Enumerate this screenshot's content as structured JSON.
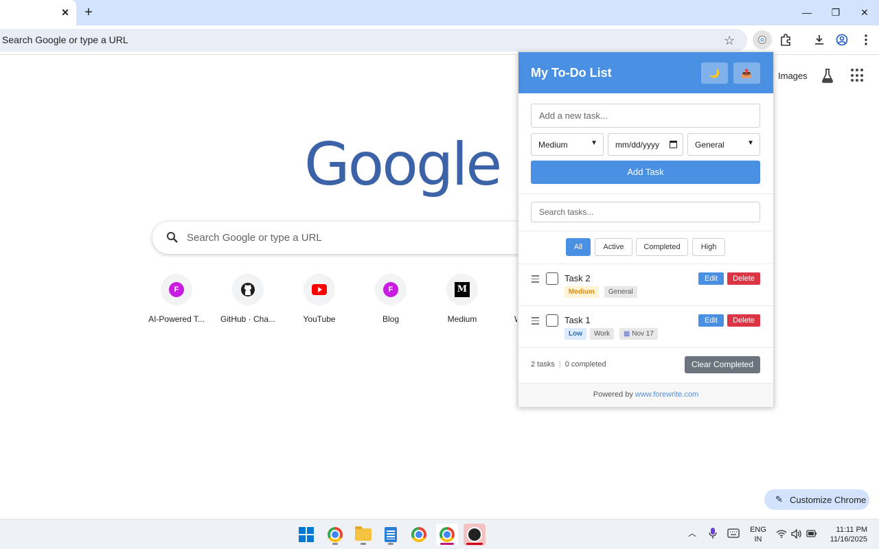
{
  "browser": {
    "omnibox_text": "Search Google or type a URL",
    "window_controls": {
      "minimize": "—",
      "restore": "❐",
      "close": "✕"
    },
    "tab_close": "✕",
    "new_tab": "+"
  },
  "ntp": {
    "images_link": "Images",
    "logo_text": "Google",
    "search_placeholder": "Search Google or type a URL",
    "shortcuts": [
      {
        "label": "AI-Powered T...",
        "icon": "f-favicon-icon",
        "glyph": "F"
      },
      {
        "label": "GitHub · Cha...",
        "icon": "github-icon"
      },
      {
        "label": "YouTube",
        "icon": "youtube-icon"
      },
      {
        "label": "Blog",
        "icon": "f-favicon-icon",
        "glyph": "F"
      },
      {
        "label": "Medium",
        "icon": "medium-icon",
        "glyph": "M"
      },
      {
        "label": "W",
        "icon": "partial-shortcut"
      }
    ],
    "customize_label": "Customize Chrome"
  },
  "popup": {
    "title": "My To-Do List",
    "theme_icon": "🌙",
    "export_icon": "📤",
    "task_placeholder": "Add a new task...",
    "priority_value": "Medium",
    "date_placeholder": "mm/dd/yyyy",
    "category_value": "General",
    "add_button": "Add Task",
    "search_placeholder": "Search tasks...",
    "filters": [
      "All",
      "Active",
      "Completed",
      "High"
    ],
    "active_filter": "All",
    "tasks": [
      {
        "name": "Task 2",
        "priority": "Medium",
        "category": "General",
        "due": "",
        "edit": "Edit",
        "delete": "Delete"
      },
      {
        "name": "Task 1",
        "priority": "Low",
        "category": "Work",
        "due": "Nov 17",
        "edit": "Edit",
        "delete": "Delete"
      }
    ],
    "stats_count": "2 tasks",
    "stats_sep": "|",
    "stats_completed": "0 completed",
    "clear_button": "Clear Completed",
    "powered_prefix": "Powered by ",
    "powered_link": "www.forewrite.com",
    "colors": {
      "header": "#4a90e2",
      "delete": "#dc3545",
      "clear": "#6c757d"
    }
  },
  "taskbar": {
    "lang_line1": "ENG",
    "lang_line2": "IN",
    "time": "11:11 PM",
    "date": "11/16/2025"
  }
}
